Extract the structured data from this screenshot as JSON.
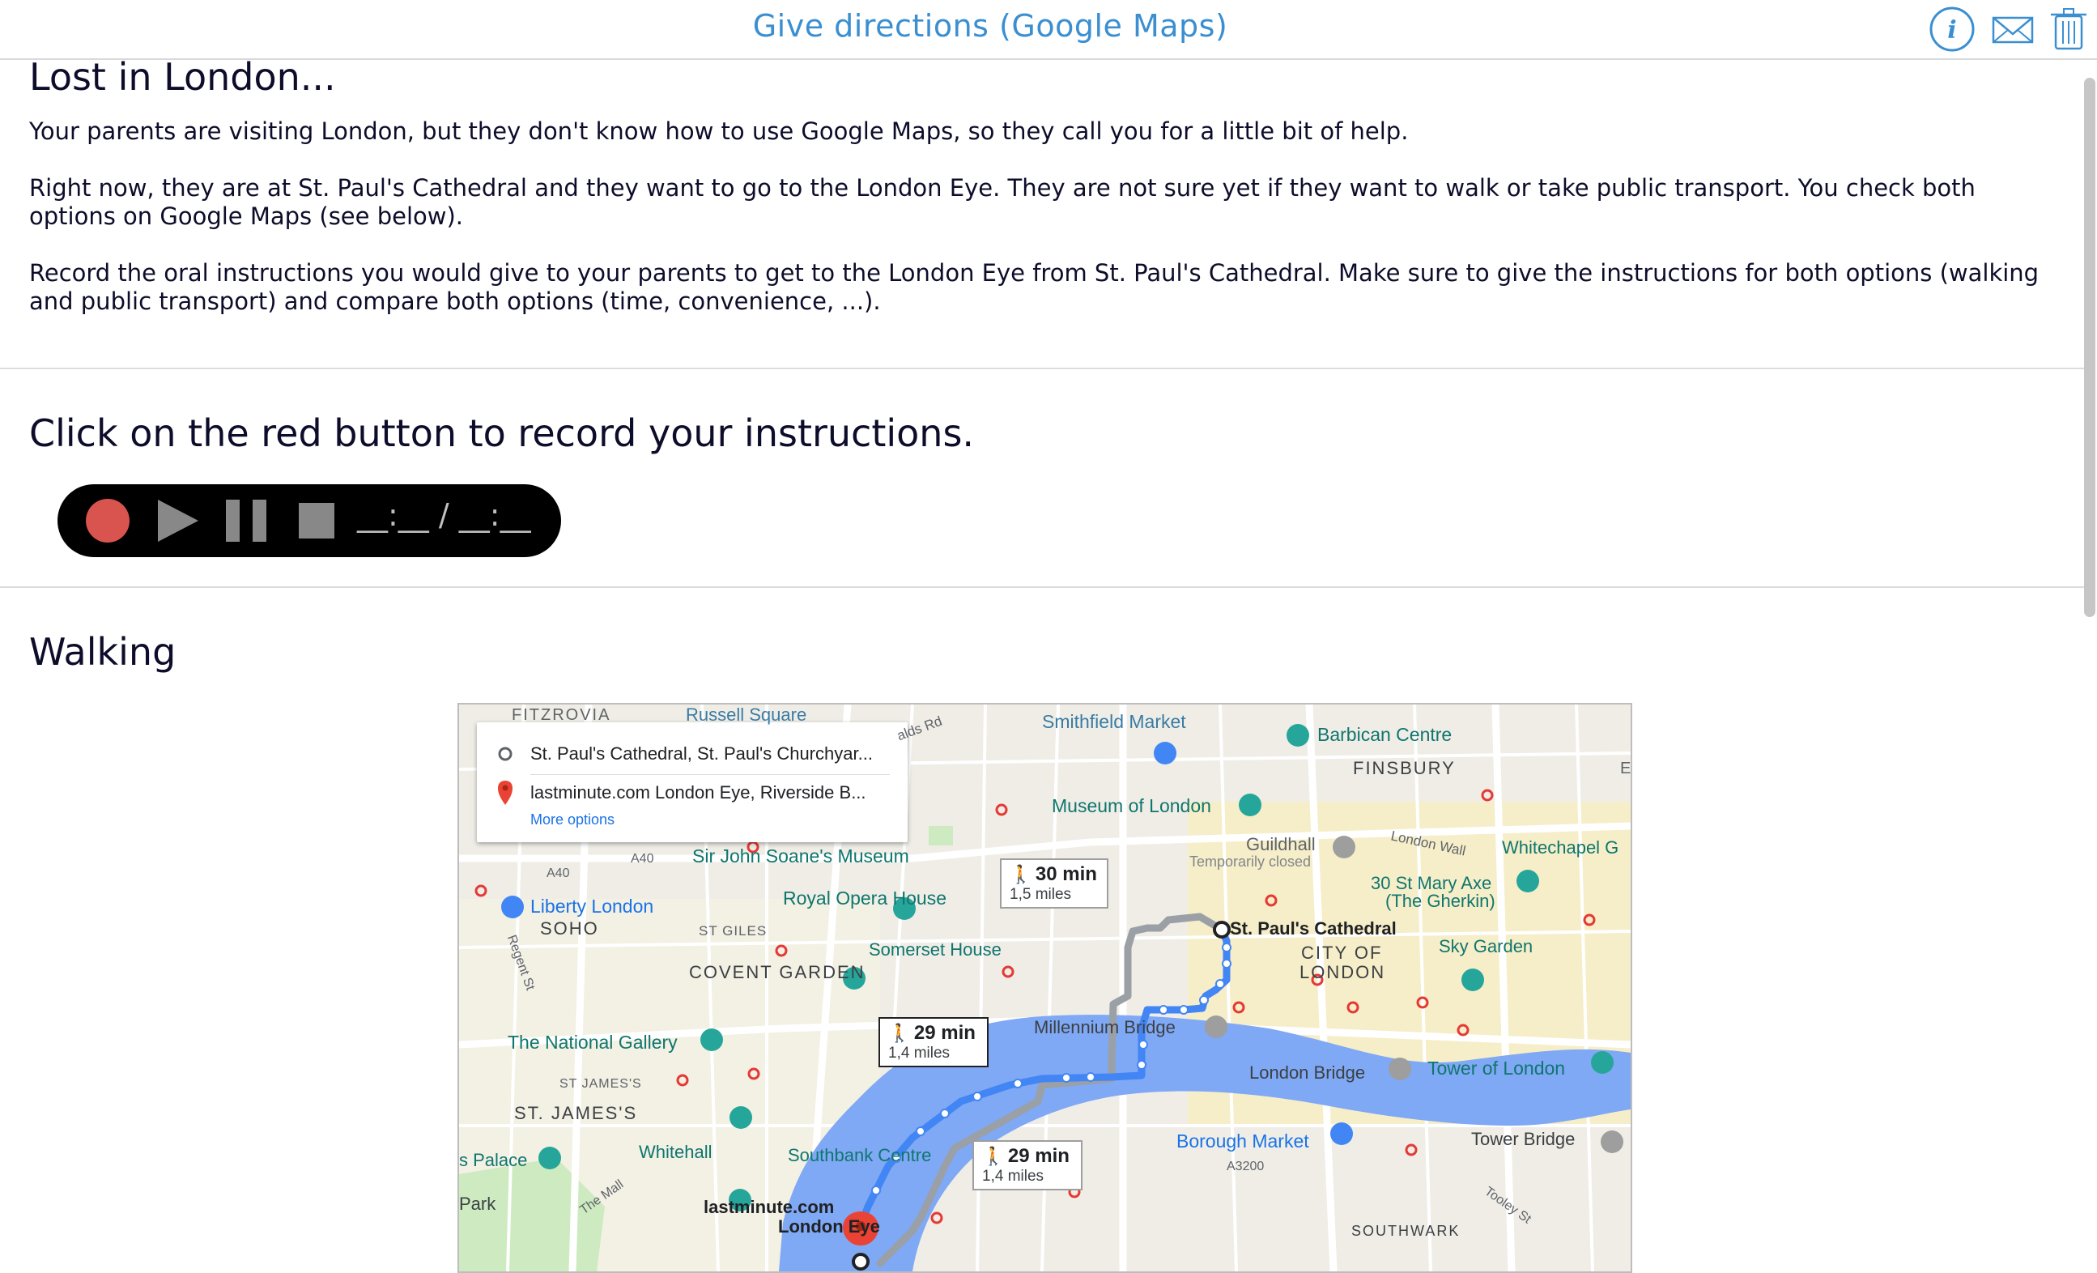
{
  "header": {
    "title": "Give directions (Google Maps)",
    "icons": [
      "info-icon",
      "mail-icon",
      "trash-icon"
    ]
  },
  "intro": {
    "title": "Lost in London...",
    "paragraphs": [
      "Your parents are visiting London, but they don't know how to use Google Maps, so they call you for a little bit of help.",
      "Right now, they are at St. Paul's Cathedral and they want to go to the London Eye. They are not sure yet if they want to walk or take public transport. You check both options on Google Maps (see below).",
      "Record the oral instructions you would give to your parents to get to the London Eye from St. Paul's Cathedral. Make sure to give the instructions for both options (walking and public transport) and compare both options (time, convenience, ...)."
    ]
  },
  "record": {
    "title": "Click on the red button to record your instructions.",
    "time": "__:__ / __:__",
    "controls": [
      "record-icon",
      "play-icon",
      "pause-icon",
      "stop-icon"
    ]
  },
  "walking": {
    "title": "Walking",
    "map": {
      "origin": "St. Paul's Cathedral, St. Paul's Churchyar...",
      "destination": "lastminute.com London Eye, Riverside B...",
      "more_options": "More options",
      "routes": [
        {
          "time": "30 min",
          "distance": "1,5 miles"
        },
        {
          "time": "29 min",
          "distance": "1,4 miles"
        },
        {
          "time": "29 min",
          "distance": "1,4 miles"
        }
      ],
      "labels": {
        "fitzrovia": "FITZROVIA",
        "russell_square": "Russell Square",
        "smithfield": "Smithfield Market",
        "barbican": "Barbican Centre",
        "finsbury": "FINSBURY",
        "museum_london": "Museum of London",
        "guildhall": "Guildhall",
        "temp_closed": "Temporarily closed",
        "london_wall": "London Wall",
        "whitechapel": "Whitechapel G",
        "a40_1": "A40",
        "a40_2": "A40",
        "soane": "Sir John Soane's Museum",
        "liberty": "Liberty London",
        "soho": "SOHO",
        "st_giles": "ST GILES",
        "royal_opera": "Royal Opera House",
        "st_pauls": "St. Paul's Cathedral",
        "mary_axe": "30 St Mary Axe",
        "gherkin": "(The Gherkin)",
        "regent_st": "Regent St",
        "somerset": "Somerset House",
        "city_of": "CITY OF",
        "london": "LONDON",
        "sky_garden": "Sky Garden",
        "covent_garden": "COVENT GARDEN",
        "millennium": "Millennium Bridge",
        "national_gallery": "The National Gallery",
        "st_jamess_small": "ST JAMES'S",
        "london_bridge": "London Bridge",
        "tower_london": "Tower of London",
        "st_jamess": "ST. JAMES'S",
        "whitehall": "Whitehall",
        "southbank": "Southbank Centre",
        "borough": "Borough Market",
        "tower_bridge": "Tower Bridge",
        "palace": "s Palace",
        "a3200": "A3200",
        "the_mall": "The Mall",
        "park": "Park",
        "lastminute": "lastminute.com",
        "london_eye": "London Eye",
        "tooley": "Tooley St",
        "southwark": "SOUTHWARK",
        "alds_rd": "alds Rd",
        "e_edge": "E"
      }
    }
  },
  "colors": {
    "title_blue": "#3b8fd1",
    "record_red": "#d9534f",
    "route_blue": "#4285f4",
    "river": "#7fa8f5"
  }
}
